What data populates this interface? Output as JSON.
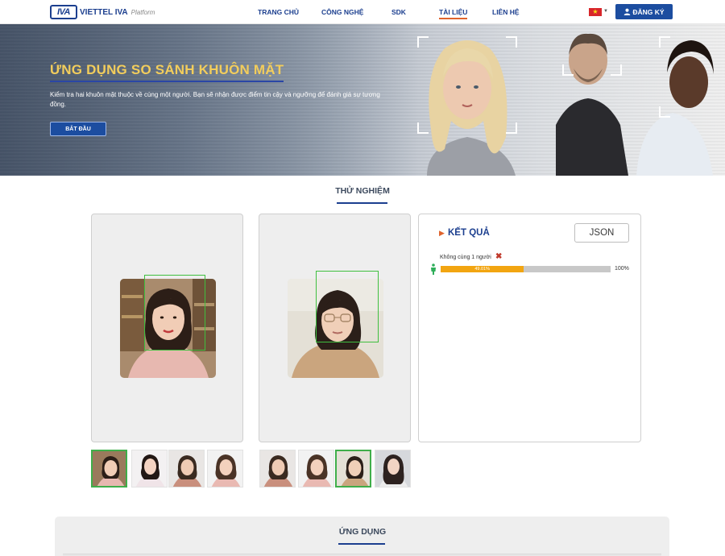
{
  "nav": {
    "logo_mark": "IVA",
    "logo_name": "VIETTEL IVA",
    "logo_sub": "Platform",
    "items": [
      {
        "label": "TRANG CHỦ"
      },
      {
        "label": "CÔNG NGHỆ"
      },
      {
        "label": "SDK"
      },
      {
        "label": "TÀI LIỆU"
      },
      {
        "label": "LIÊN HỆ"
      }
    ],
    "active_index": 3,
    "language": "VN",
    "register_label": "ĐĂNG KÝ"
  },
  "hero": {
    "title": "ỨNG DỤNG SO SÁNH KHUÔN MẶT",
    "description": "Kiểm tra hai khuôn mặt thuộc về cùng một người. Bạn sẽ nhận được điểm tin cậy và ngưỡng để đánh giá sự tương đồng.",
    "button_label": "BẮT ĐẦU"
  },
  "section_title": "THỬ NGHIỆM",
  "result": {
    "title": "KẾT QUẢ",
    "json_button": "JSON",
    "verdict": "Không cùng 1 người",
    "score_label": "49.01%",
    "score_fraction": 0.4901,
    "max_label": "100%"
  },
  "thumbs_left": {
    "selected": 0,
    "count": 4
  },
  "thumbs_right": {
    "selected": 2,
    "count": 4
  },
  "bottom_title": "ỨNG DỤNG",
  "colors": {
    "brand": "#1c3f8f",
    "accent": "#e0632c",
    "detect_box": "#3fbf3f",
    "bar_fill": "#f2a511",
    "hero_title": "#f2cd5c"
  }
}
